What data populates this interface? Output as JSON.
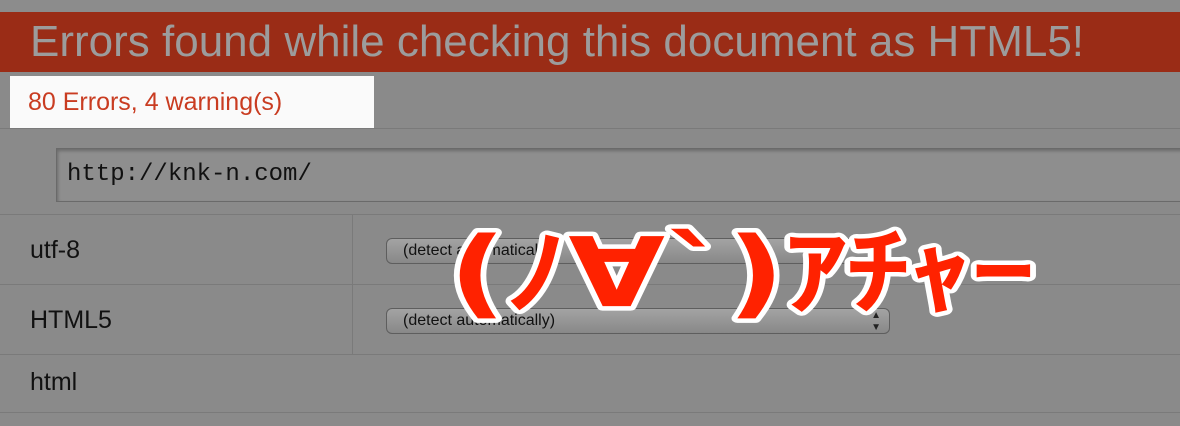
{
  "banner": {
    "title": "Errors found while checking this document as HTML5!"
  },
  "summary": {
    "text": "80 Errors, 4 warning(s)"
  },
  "form": {
    "url_value": "http://knk-n.com/",
    "rows": [
      {
        "label": "utf-8",
        "select_value": "(detect automatically)"
      },
      {
        "label": "HTML5",
        "select_value": "(detect automatically)"
      },
      {
        "label": "html"
      }
    ]
  },
  "overlay": {
    "text": "(ﾉ∀`)ｱﾁｬｰ",
    "color": "#ff2200"
  },
  "colors": {
    "banner_bg": "#9a2c16",
    "summary_text": "#c93c21",
    "page_bg": "#8a8a8a"
  }
}
